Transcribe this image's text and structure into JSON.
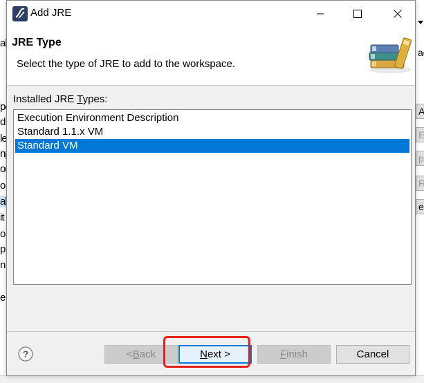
{
  "window": {
    "title": "Add JRE",
    "minimize_icon": "minimize-icon",
    "maximize_icon": "maximize-icon",
    "close_icon": "close-icon"
  },
  "header": {
    "title": "JRE Type",
    "description": "Select the type of JRE to add to the workspace.",
    "image_icon": "stacked-books-icon"
  },
  "list": {
    "label_pre": "Installed JRE ",
    "label_mnemonic": "T",
    "label_post": "ypes:",
    "items": [
      {
        "label": "Execution Environment Description",
        "selected": false
      },
      {
        "label": "Standard 1.1.x VM",
        "selected": false
      },
      {
        "label": "Standard VM",
        "selected": true
      }
    ]
  },
  "buttons": {
    "back_pre": "< ",
    "back_mn": "B",
    "back_post": "ack",
    "next_mn": "N",
    "next_post": "ext >",
    "finish_mn": "F",
    "finish_post": "inish",
    "cancel": "Cancel"
  },
  "background": {
    "left_fragments": [
      "al",
      "pe",
      "d",
      "le",
      "np",
      "ou",
      "o",
      "al",
      "it",
      "o",
      "p",
      "n",
      "e"
    ],
    "right_fragments": [
      "ac",
      "al",
      "e"
    ],
    "right_buttons": [
      "A",
      "E",
      "p",
      "R",
      "e"
    ]
  },
  "colors": {
    "selection": "#0078d7",
    "highlight_box": "#e8221b"
  }
}
